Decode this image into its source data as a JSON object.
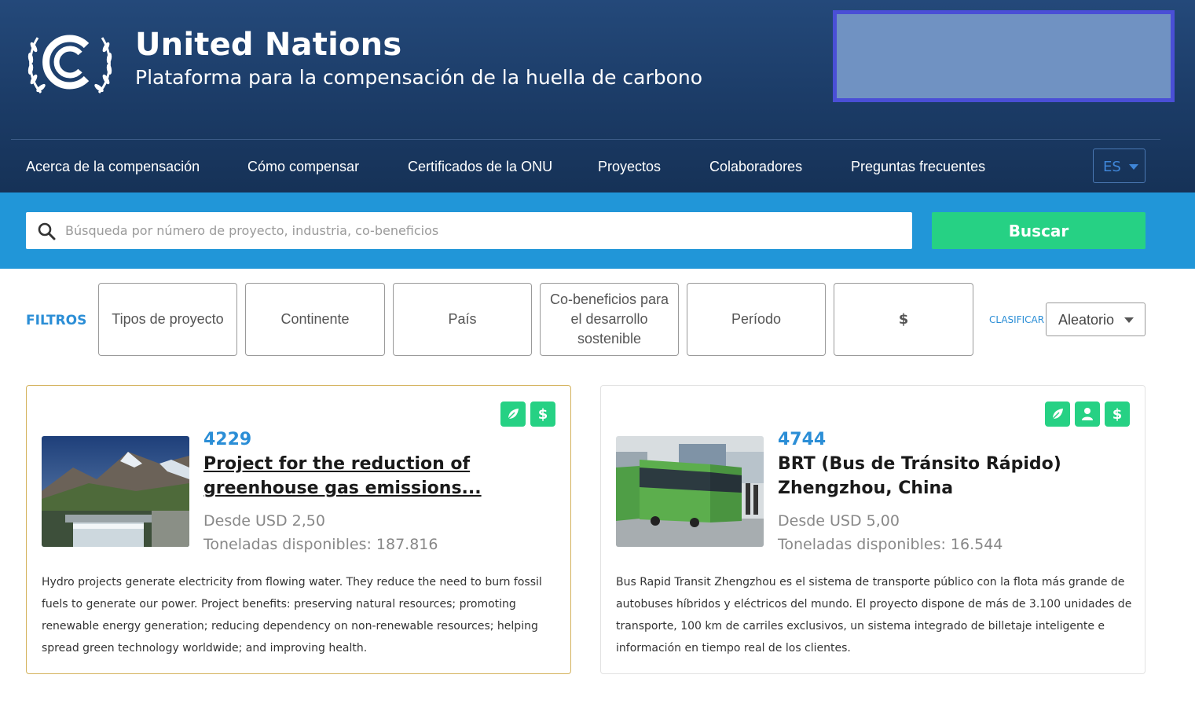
{
  "header": {
    "title": "United Nations",
    "subtitle": "Plataforma para la compensación de la huella de carbono"
  },
  "nav": {
    "items": [
      {
        "label": "Acerca de la compensación"
      },
      {
        "label": "Cómo compensar"
      },
      {
        "label": "Certificados de la ONU"
      },
      {
        "label": "Proyectos"
      },
      {
        "label": "Colaboradores"
      },
      {
        "label": "Preguntas frecuentes"
      }
    ],
    "language": "ES"
  },
  "search": {
    "placeholder": "Búsqueda por número de proyecto, industria, co-beneficios",
    "value": "",
    "button_label": "Buscar"
  },
  "filters": {
    "label": "FILTROS",
    "items": [
      {
        "label": "Tipos de proyecto"
      },
      {
        "label": "Continente"
      },
      {
        "label": "País"
      },
      {
        "label": "Co-beneficios para el desarrollo sostenible"
      },
      {
        "label": "Período"
      },
      {
        "label": "$"
      }
    ],
    "sort_label": "CLASIFICAR",
    "sort_value": "Aleatorio"
  },
  "projects": [
    {
      "id": "4229",
      "title": "Project for the reduction of greenhouse gas emissions...",
      "price": "Desde USD 2,50",
      "tons": "Toneladas disponibles: 187.816",
      "description": "Hydro projects generate electricity from flowing water. They reduce the need to burn fossil fuels to generate our power. Project benefits: preserving natural resources; promoting renewable energy generation; reducing dependency on non-renewable resources; helping spread green technology worldwide; and improving health.",
      "badges": [
        "leaf-icon",
        "dollar-icon"
      ],
      "dollar_glyph": "$"
    },
    {
      "id": "4744",
      "title": "BRT (Bus de Tránsito Rápido) Zhengzhou, China",
      "price": "Desde USD 5,00",
      "tons": "Toneladas disponibles: 16.544",
      "description": "Bus Rapid Transit Zhengzhou es el sistema de transporte público con la flota más grande de autobuses híbridos y eléctricos del mundo. El proyecto dispone de más de 3.100 unidades de transporte, 100 km de carriles exclusivos, un sistema integrado de billetaje inteligente e información en tiempo real de los clientes.",
      "badges": [
        "leaf-icon",
        "person-icon",
        "dollar-icon"
      ],
      "dollar_glyph": "$"
    }
  ],
  "colors": {
    "header_bg": "#1b3b66",
    "search_band": "#2196d8",
    "accent_green": "#26d184",
    "accent_blue": "#2b8ed6",
    "highlight_box": "#7092c2"
  }
}
